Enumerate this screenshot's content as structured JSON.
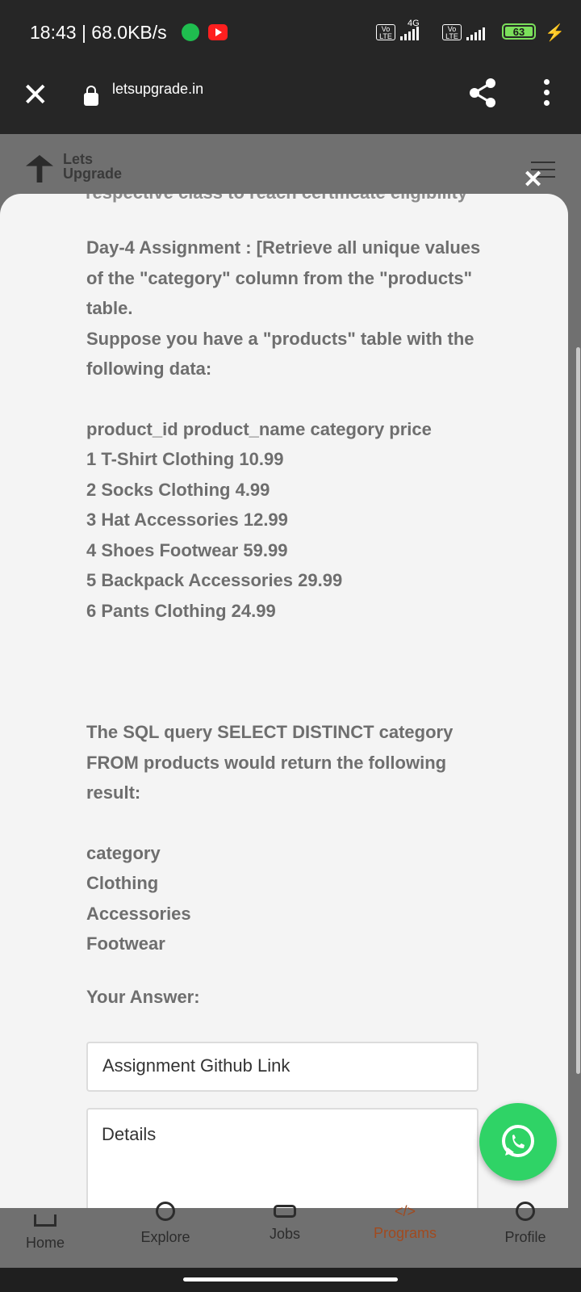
{
  "status_bar": {
    "time_speed": "18:43 | 68.0KB/s",
    "network_label": "4G",
    "volte_label": "Vo LTE",
    "battery_level": "63"
  },
  "browser": {
    "url": "letsupgrade.in"
  },
  "site": {
    "logo_line1": "Lets",
    "logo_line2": "Upgrade"
  },
  "modal": {
    "clipped_text": "respective class to reach certificate eligibility",
    "assignment_lines": [
      "Day-4 Assignment : [Retrieve all unique values of the \"category\" column from the \"products\" table.",
      "Suppose you have a \"products\" table with the following data:"
    ],
    "table_lines": [
      "product_id product_name category price",
      "1 T-Shirt Clothing 10.99",
      "2 Socks Clothing 4.99",
      "3 Hat Accessories 12.99",
      "4 Shoes Footwear 59.99",
      "5 Backpack Accessories 29.99",
      "6 Pants Clothing 24.99"
    ],
    "query_text": "The SQL query SELECT DISTINCT category FROM products would return the following result:",
    "result_lines": [
      "category",
      "Clothing",
      "Accessories",
      "Footwear"
    ],
    "answer_label": "Your Answer:",
    "github_placeholder": "Assignment Github Link",
    "details_placeholder": "Details"
  },
  "bottom_nav": {
    "items": [
      {
        "label": "Home",
        "icon": "home-icon"
      },
      {
        "label": "Explore",
        "icon": "compass-icon"
      },
      {
        "label": "Jobs",
        "icon": "briefcase-icon"
      },
      {
        "label": "Programs",
        "icon": "code-icon"
      },
      {
        "label": "Profile",
        "icon": "profile-icon"
      }
    ]
  },
  "colors": {
    "active_nav": "#a14a1f",
    "whatsapp": "#2fd366"
  }
}
